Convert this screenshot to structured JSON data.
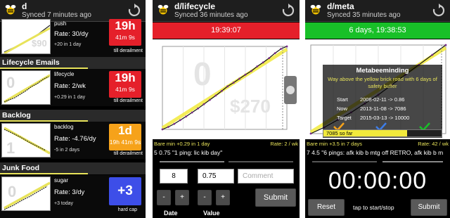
{
  "screens": [
    {
      "header": {
        "title": "d",
        "subtitle": "Synced 7 minutes ago"
      },
      "goals_top": {
        "name": "push",
        "rate": "Rate: 30/dy",
        "delta": "+20 in 1 day",
        "badge_big": "19h",
        "badge_small": "41m 9s",
        "note": "till derailment",
        "badge_color": "#e5202a"
      },
      "sections": [
        {
          "title": "Lifecycle Emails"
        },
        {
          "title": "Backlog"
        },
        {
          "title": "Junk Food"
        }
      ],
      "goals": [
        {
          "name": "lifecycle",
          "rate": "Rate: 2/wk",
          "delta": "+0.29 in 1 day",
          "badge_big": "19h",
          "badge_small": "41m 9s",
          "note": "till derailment",
          "badge_color": "#e5202a",
          "thumb_ghost": "0"
        },
        {
          "name": "backlog",
          "rate": "Rate: -4.76/dy",
          "delta": "-5 in 2 days",
          "badge_big": "1d",
          "badge_small": "19h 41m 9s",
          "note": "till derailment",
          "badge_color": "#f6a21a",
          "thumb_ghost": "1"
        },
        {
          "name": "sugar",
          "rate": "Rate: 3/dy",
          "delta": "+3 today",
          "badge_big": "+3",
          "badge_small": "",
          "note": "hard cap",
          "badge_color": "#3d4ee8",
          "thumb_ghost": "0"
        }
      ]
    },
    {
      "header": {
        "title": "d/lifecycle",
        "subtitle": "Synced 36 minutes ago"
      },
      "countdown": {
        "text": "19:39:07",
        "color": "#e5202a"
      },
      "graph_ghost": {
        "big": "0",
        "amount": "$270"
      },
      "status": {
        "left": "Bare min +0.29 in 1 day",
        "right": "Rate: 2 / wk"
      },
      "ping": "5 0.75 \"1 ping: lic kib day\"",
      "form": {
        "date_value": "8",
        "value_value": "0.75",
        "comment_placeholder": "Comment",
        "submit_label": "Submit",
        "date_label": "Date",
        "value_label": "Value",
        "minus": "-",
        "plus": "+"
      },
      "chart_data": {
        "type": "line",
        "title": "",
        "xlabel": "",
        "ylabel": "",
        "series": [
          {
            "values": [
              0,
              8,
              18,
              30,
              42,
              55,
              68,
              82,
              96,
              110,
              125,
              140,
              152,
              165,
              178,
              190,
              205,
              218,
              232,
              248,
              262,
              270
            ]
          }
        ],
        "grid": true
      }
    },
    {
      "header": {
        "title": "d/meta",
        "subtitle": "Synced 35 minutes ago"
      },
      "countdown": {
        "text": "6 days, 19:38:53",
        "color": "#18c028"
      },
      "overlay": {
        "title": "Metabeeminding",
        "subtitle": "Way above the yellow brick road with 6 days of safety buffer",
        "rows": [
          {
            "k": "Start",
            "v": "2008-02-11 -> 0.86"
          },
          {
            "k": "Now",
            "v": "2013-11-08 -> 7086"
          },
          {
            "k": "Target",
            "v": "2015-03-13 -> 10000"
          }
        ],
        "progress_text": "7085 so far",
        "progress_fraction": 0.71
      },
      "status": {
        "left": "Bare min +3.5 in 7 days",
        "right": "Rate: 42 / wk"
      },
      "ping": "7 4.5 \"6 pings: afk kib b mtg off RETRO, afk kib b m",
      "timer": "00:00:00",
      "reset_label": "Reset",
      "tap_label": "tap to start/stop",
      "submit_label": "Submit",
      "chart_data": {
        "type": "line",
        "title": "",
        "xlabel": "",
        "ylabel": "",
        "series": [
          {
            "values": [
              0.86,
              500,
              1100,
              1700,
              2400,
              3100,
              3900,
              4700,
              5500,
              6300,
              7086
            ]
          }
        ],
        "grid": true
      }
    }
  ],
  "colors": {
    "accent_yellow": "#e8e35a",
    "red": "#e5202a",
    "green": "#18c028",
    "orange": "#f6a21a",
    "blue": "#3d4ee8"
  },
  "icons": {
    "logo": "bee-logo-icon",
    "refresh": "refresh-icon"
  }
}
